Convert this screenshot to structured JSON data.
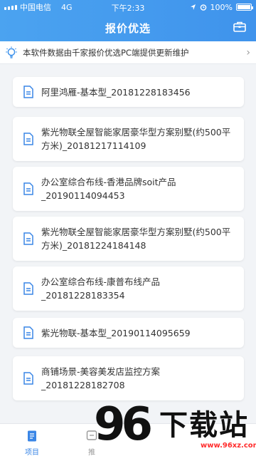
{
  "status": {
    "carrier": "中国电信",
    "network": "4G",
    "time": "下午2:33",
    "battery": "100%"
  },
  "header": {
    "title": "报价优选"
  },
  "notice": {
    "text": "本软件数据由千家报价优选PC端提供更新维护"
  },
  "projects": [
    "阿里鸿雁-基本型_20181228183456",
    "紫光物联全屋智能家居豪华型方案别墅(约500平方米)_20181217114109",
    "办公室综合布线-香港品牌soit产品_20190114094453",
    "紫光物联全屋智能家居豪华型方案别墅(约500平方米)_20181224184148",
    "办公室综合布线-康普布线产品_20181228183354",
    "紫光物联-基本型_20190114095659",
    "商铺场景-美容美发店监控方案_20181228182708"
  ],
  "tabs": [
    {
      "label": "项目",
      "active": true
    },
    {
      "label": "推"
    }
  ],
  "watermark": {
    "number": "96",
    "text": "下载站",
    "url": "www.96xz.com"
  },
  "colors": {
    "primary": "#3f93ec",
    "accent_active": "#3a86e6",
    "background": "#f2f4f7"
  }
}
